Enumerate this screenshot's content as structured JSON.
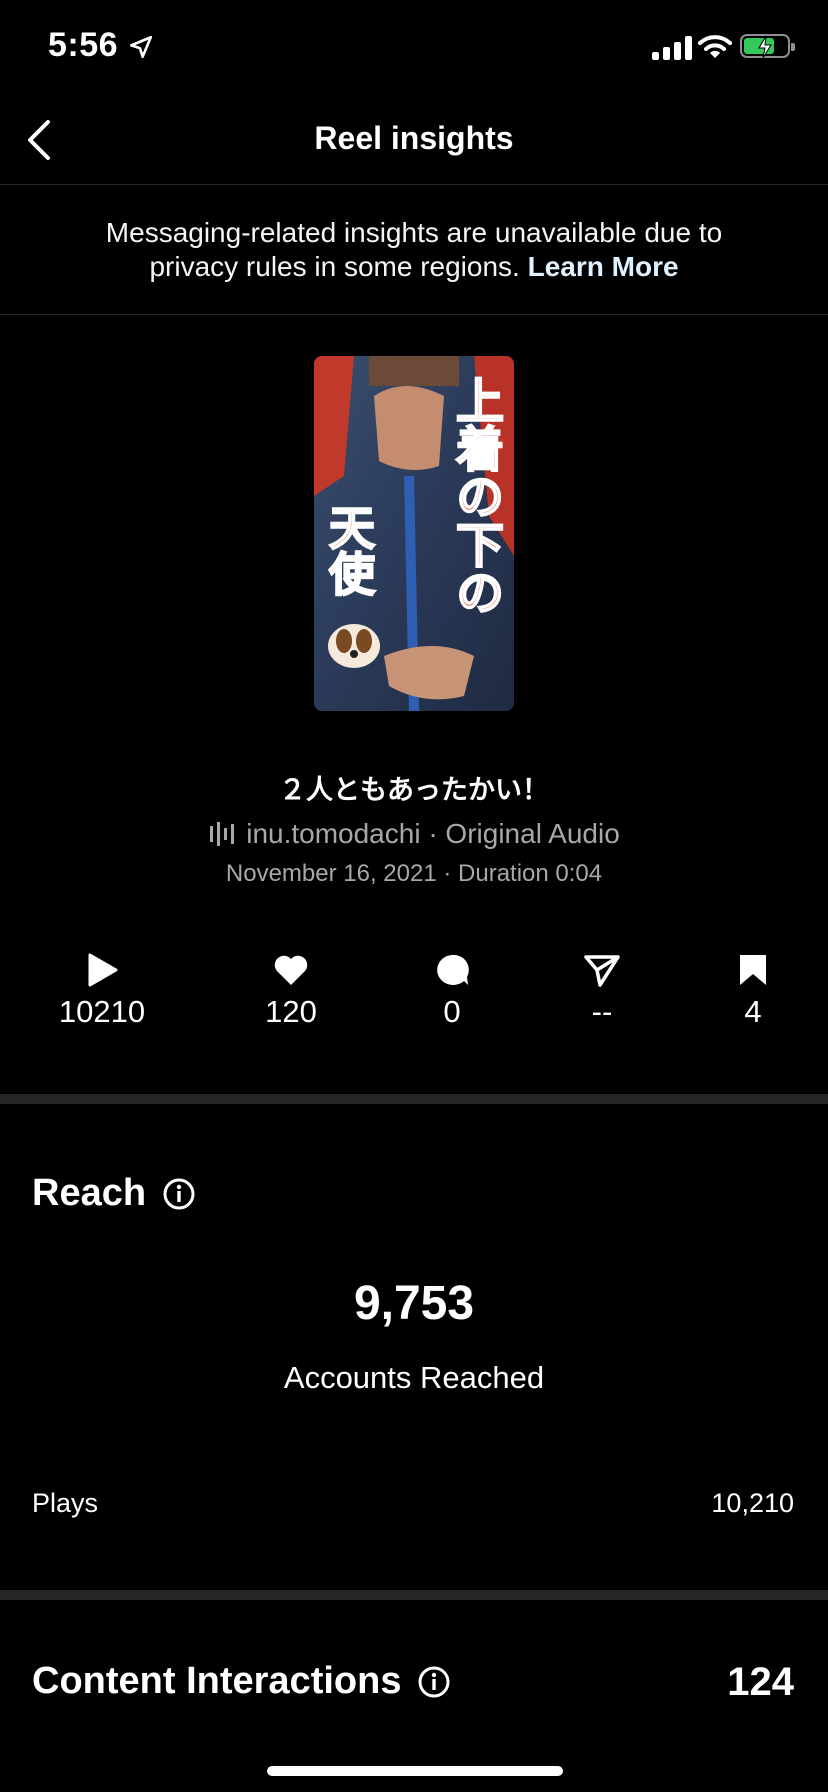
{
  "status_bar": {
    "time": "5:56"
  },
  "header": {
    "title": "Reel insights"
  },
  "notice": {
    "text": "Messaging-related insights are unavailable due to privacy rules in some regions.",
    "link": "Learn More"
  },
  "reel": {
    "overlay_line1": "上着の下の",
    "overlay_line2": "天使",
    "caption": "２人ともあったかい！",
    "audio": "inu.tomodachi · Original Audio",
    "meta": "November 16, 2021 · Duration 0:04"
  },
  "stats": {
    "plays": "10210",
    "likes": "120",
    "comments": "0",
    "shares": "--",
    "saves": "4"
  },
  "reach": {
    "title": "Reach",
    "value": "9,753",
    "label": "Accounts Reached",
    "plays_label": "Plays",
    "plays_value": "10,210"
  },
  "content_interactions": {
    "title": "Content Interactions",
    "value": "124"
  }
}
